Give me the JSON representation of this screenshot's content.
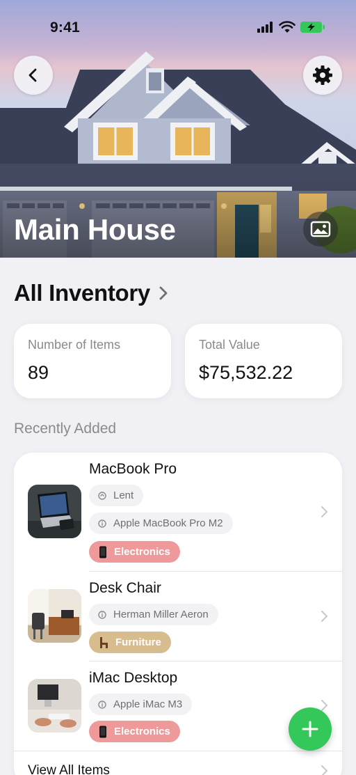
{
  "status_bar": {
    "time": "9:41"
  },
  "hero": {
    "title": "Main House"
  },
  "section": {
    "title": "All Inventory"
  },
  "stats": [
    {
      "label": "Number of Items",
      "value": "89"
    },
    {
      "label": "Total Value",
      "value": "$75,532.22"
    }
  ],
  "recent": {
    "title": "Recently Added",
    "items": [
      {
        "name": "MacBook Pro",
        "status": "Lent",
        "detail": "Apple MacBook Pro M2",
        "category": "Electronics",
        "category_color": "#ef9a9a"
      },
      {
        "name": "Desk Chair",
        "detail": "Herman Miller Aeron",
        "category": "Furniture",
        "category_color": "#d7bd8e"
      },
      {
        "name": "iMac Desktop",
        "detail": "Apple iMac M3",
        "category": "Electronics",
        "category_color": "#ef9a9a"
      }
    ],
    "view_all_label": "View All Items"
  },
  "colors": {
    "accent_green": "#34c759",
    "background": "#f1f1f5"
  },
  "icons": [
    "back-chevron-icon",
    "gear-icon",
    "photo-icon",
    "lent-icon",
    "info-icon",
    "phone-icon",
    "chair-icon",
    "chevron-right-icon",
    "plus-icon"
  ]
}
